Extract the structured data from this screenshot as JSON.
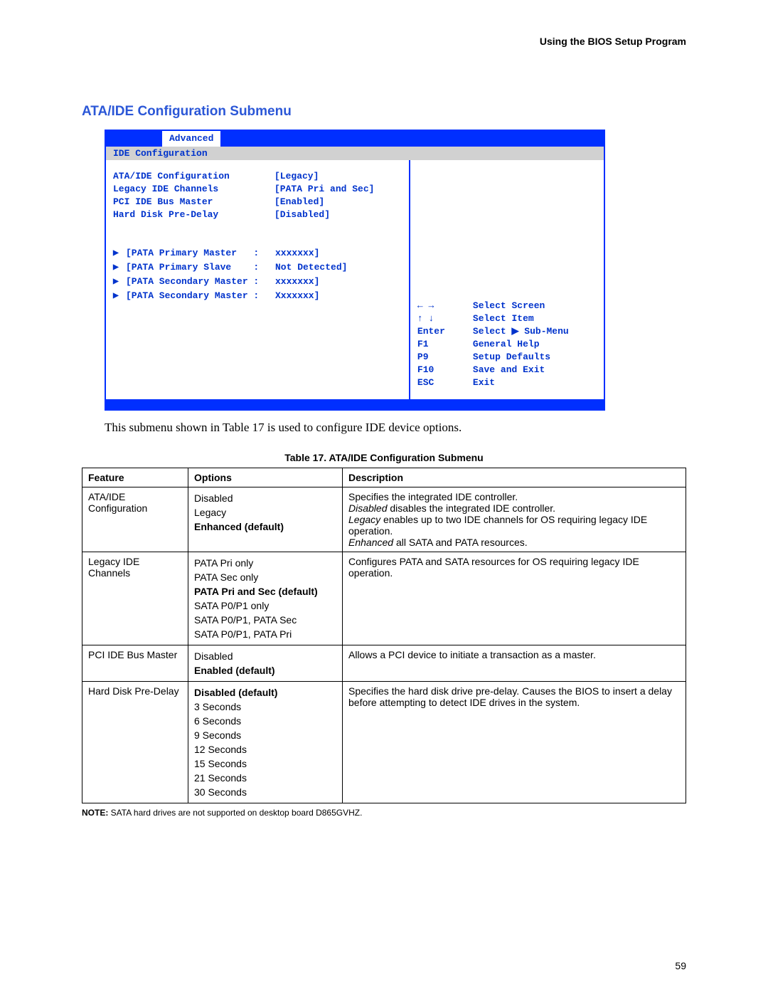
{
  "header": "Using the BIOS Setup Program",
  "section_title": "ATA/IDE Configuration Submenu",
  "bios": {
    "active_tab": "Advanced",
    "subtitle": "IDE Configuration",
    "settings": [
      {
        "label": "ATA/IDE Configuration",
        "value": "[Legacy]"
      },
      {
        "label": "Legacy IDE Channels",
        "value": "[PATA Pri and Sec]"
      },
      {
        "label": "PCI IDE Bus Master",
        "value": "[Enabled]"
      },
      {
        "label": "Hard Disk Pre-Delay",
        "value": "[Disabled]"
      }
    ],
    "devices": [
      {
        "label": "[PATA Primary Master   :",
        "value": "xxxxxxx]"
      },
      {
        "label": "[PATA Primary Slave    :",
        "value": "Not Detected]"
      },
      {
        "label": "[PATA Secondary Master :",
        "value": "xxxxxxx]"
      },
      {
        "label": "[PATA Secondary Master :",
        "value": "Xxxxxxx]"
      }
    ],
    "help": [
      {
        "key": "← →",
        "desc": "Select Screen"
      },
      {
        "key": "↑ ↓",
        "desc": "Select Item"
      },
      {
        "key": "Enter",
        "desc": "Select ▶ Sub-Menu"
      },
      {
        "key": "F1",
        "desc": "General Help"
      },
      {
        "key": "P9",
        "desc": "Setup Defaults"
      },
      {
        "key": "F10",
        "desc": "Save and Exit"
      },
      {
        "key": "ESC",
        "desc": "Exit"
      }
    ]
  },
  "caption": "This submenu shown in Table 17 is used to configure IDE device options.",
  "table": {
    "title": "Table 17.   ATA/IDE Configuration Submenu",
    "headers": {
      "c1": "Feature",
      "c2": "Options",
      "c3": "Description"
    },
    "rows": [
      {
        "feature": "ATA/IDE Configuration",
        "options": [
          {
            "text": "Disabled",
            "bold": false
          },
          {
            "text": "Legacy",
            "bold": false
          },
          {
            "text": "Enhanced (default)",
            "bold": true
          }
        ],
        "desc_plain1": "Specifies the integrated IDE controller.",
        "desc_em1_i": "Disabled",
        "desc_em1_r": " disables the integrated IDE controller.",
        "desc_em2_i": "Legacy",
        "desc_em2_r": " enables up to two IDE channels for OS requiring legacy IDE operation.",
        "desc_em3_i": "Enhanced",
        "desc_em3_r": " all SATA and PATA resources."
      },
      {
        "feature": "Legacy IDE Channels",
        "options": [
          {
            "text": "PATA Pri only",
            "bold": false
          },
          {
            "text": "PATA Sec only",
            "bold": false
          },
          {
            "text": "PATA Pri and Sec (default)",
            "bold": true
          },
          {
            "text": "SATA P0/P1 only",
            "bold": false
          },
          {
            "text": "SATA P0/P1, PATA Sec",
            "bold": false
          },
          {
            "text": "SATA P0/P1, PATA Pri",
            "bold": false
          }
        ],
        "desc": "Configures PATA and SATA resources for OS requiring legacy IDE operation."
      },
      {
        "feature": "PCI IDE Bus Master",
        "options": [
          {
            "text": "Disabled",
            "bold": false
          },
          {
            "text": "Enabled (default)",
            "bold": true
          }
        ],
        "desc": "Allows a PCI device to initiate a transaction as a master."
      },
      {
        "feature": "Hard Disk Pre-Delay",
        "options": [
          {
            "text": "Disabled (default)",
            "bold": true
          },
          {
            "text": "3 Seconds",
            "bold": false
          },
          {
            "text": "6 Seconds",
            "bold": false
          },
          {
            "text": "9 Seconds",
            "bold": false
          },
          {
            "text": "12 Seconds",
            "bold": false
          },
          {
            "text": "15 Seconds",
            "bold": false
          },
          {
            "text": "21 Seconds",
            "bold": false
          },
          {
            "text": "30 Seconds",
            "bold": false
          }
        ],
        "desc": "Specifies the hard disk drive pre-delay.  Causes the BIOS to insert a delay before attempting to detect IDE drives in the system."
      }
    ]
  },
  "note_label": "NOTE:  ",
  "note_text": "SATA hard drives are not supported on desktop board D865GVHZ.",
  "page_number": "59"
}
